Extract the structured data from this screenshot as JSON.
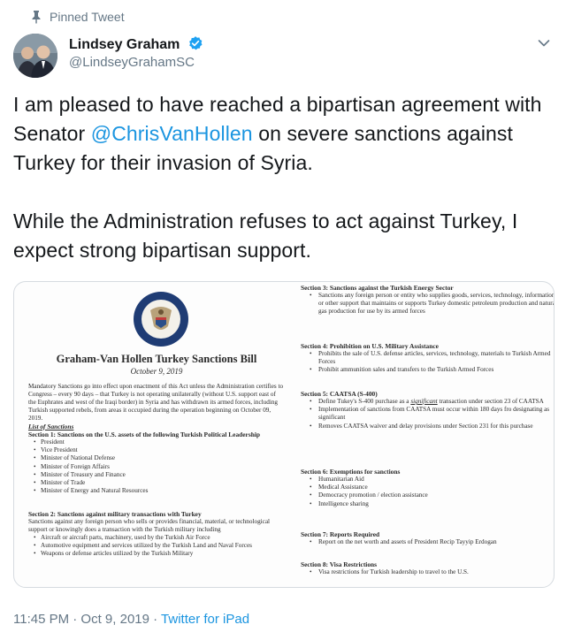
{
  "pinned_label": "Pinned Tweet",
  "author": {
    "name": "Lindsey Graham",
    "handle": "@LindseyGrahamSC"
  },
  "tweet": {
    "line1_pre": "I am pleased to have reached a bipartisan agreement with Senator ",
    "mention": "@ChrisVanHollen",
    "line1_post": " on severe sanctions against Turkey for their invasion of Syria.",
    "paragraph2": "While the Administration refuses to act against Turkey, I expect strong bipartisan support."
  },
  "document": {
    "title": "Graham-Van Hollen Turkey Sanctions Bill",
    "date": "October 9, 2019",
    "intro": "Mandatory Sanctions go into effect upon enactment of this Act unless the Administration certifies to Congress – every 90 days – that Turkey is not operating unilaterally (without U.S. support east of the Euphrates and west of the Iraqi border) in Syria and has withdrawn its armed forces, including Turkish supported rebels, from areas it occupied during the operation beginning on October 09, 2019.",
    "list_heading": "List of Sanctions",
    "sec1_heading": "Section 1: Sanctions on the U.S. assets of the following Turkish Political Leadership",
    "sec1_items": [
      "President",
      "Vice President",
      "Minister of National Defense",
      "Minister of Foreign Affairs",
      "Minister of Treasury and Finance",
      "Minister of Trade",
      "Minister of Energy and Natural Resources"
    ],
    "sec2_heading": "Section 2: Sanctions against military transactions with Turkey",
    "sec2_text": "Sanctions against any foreign person who sells or provides financial, material, or technological support or knowingly does a transaction with the Turkish military including",
    "sec2_items": [
      "Aircraft or aircraft parts, machinery, used by the Turkish Air Force",
      "Automotive equipment and services utilized by the Turkish Land and Naval Forces",
      "Weapons or defense articles utilized by the Turkish Military"
    ],
    "sec3_heading": "Section 3: Sanctions against the Turkish Energy Sector",
    "sec3_items": [
      "Sanctions any foreign person or entity who supplies goods, services, technology, information, or other support that maintains or supports Turkey domestic petroleum production and natural gas production for use by its armed forces"
    ],
    "sec4_heading": "Section 4: Prohibition on U.S. Military Assistance",
    "sec4_items": [
      "Prohibits the sale of U.S. defense articles, services, technology, materials to Turkish Armed Forces",
      "Prohibit ammunition sales and transfers to the Turkish Armed Forces"
    ],
    "sec5_heading": "Section 5: CAATSA (S-400)",
    "sec5_item1_pre": "Define Tukey's S-400 purchase as a ",
    "sec5_item1_em": "significant",
    "sec5_item1_post": " transaction under section 23 of CAATSA",
    "sec5_items": [
      "Implementation of sanctions from CAATSA must occur within 180 days fro designating as significant",
      "Removes CAATSA waiver and delay provisions under Section 231 for this purchase"
    ],
    "sec6_heading": "Section 6: Exemptions for sanctions",
    "sec6_items": [
      "Humanitarian Aid",
      "Medical Assistance",
      "Democracy promotion / election assistance",
      "Intelligence sharing"
    ],
    "sec7_heading": "Section 7: Reports Required",
    "sec7_items": [
      "Report on the net worth and assets of President Recip Tayyip Erdogan"
    ],
    "sec8_heading": "Section 8: Visa Restrictions",
    "sec8_items": [
      "Visa restrictions for Turkish leadership to travel to the U.S."
    ]
  },
  "footer": {
    "time": "11:45 PM · Oct 9, 2019 · ",
    "source": "Twitter for iPad"
  },
  "colors": {
    "link": "#1b95e0",
    "secondary_text": "#657786",
    "verified": "#1da1f2"
  }
}
